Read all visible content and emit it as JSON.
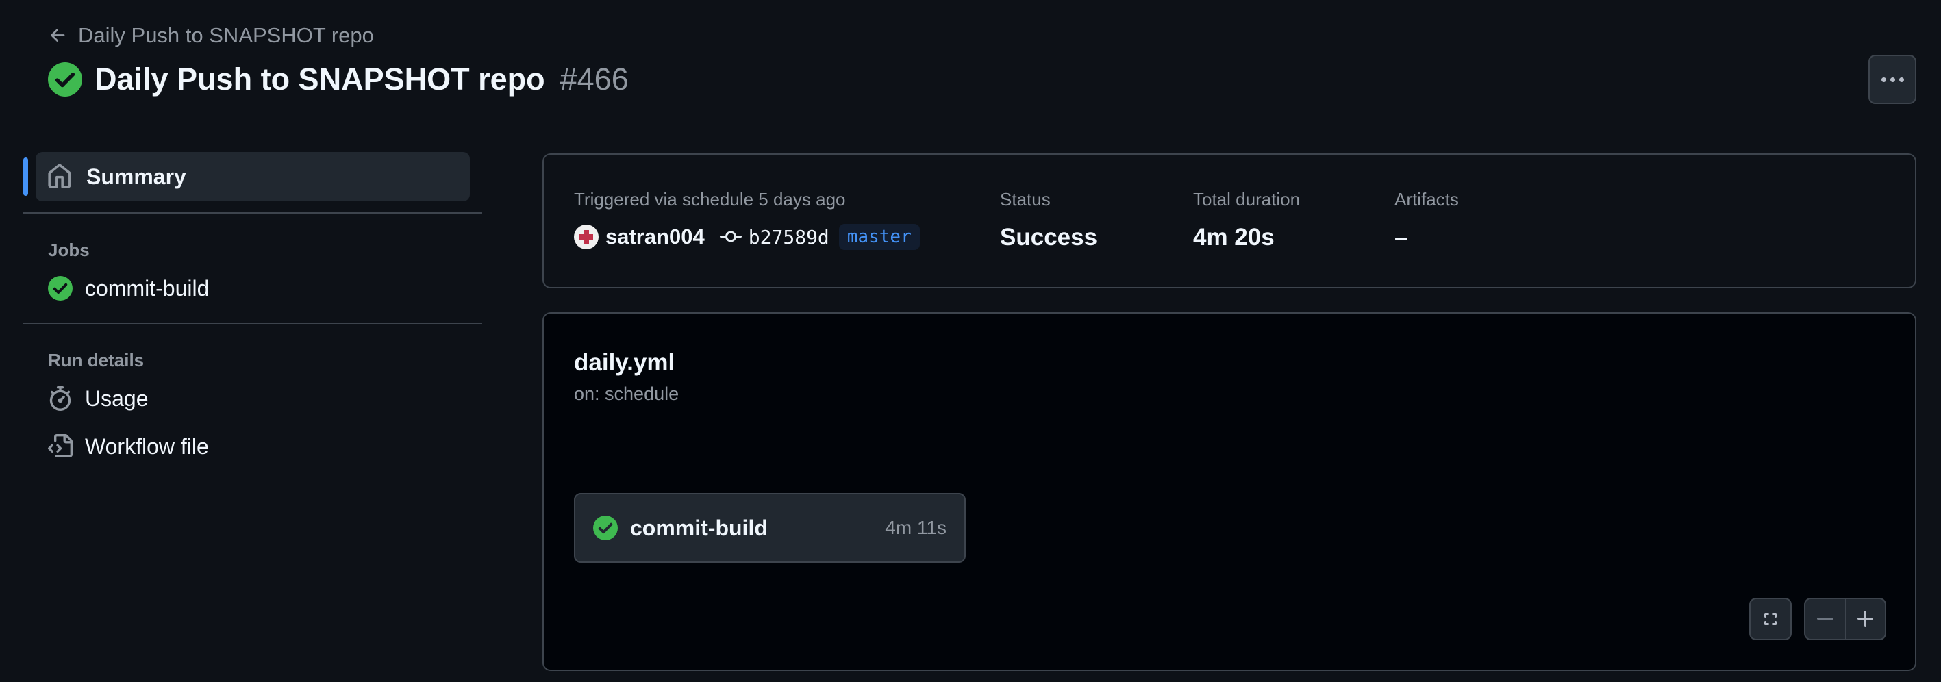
{
  "header": {
    "back_label": "Daily Push to SNAPSHOT repo",
    "title": "Daily Push to SNAPSHOT repo",
    "run_number": "#466"
  },
  "sidebar": {
    "summary_label": "Summary",
    "jobs_heading": "Jobs",
    "jobs": [
      {
        "label": "commit-build",
        "status": "success"
      }
    ],
    "run_details_heading": "Run details",
    "run_details": [
      {
        "label": "Usage",
        "icon": "stopwatch-icon"
      },
      {
        "label": "Workflow file",
        "icon": "file-code-icon"
      }
    ]
  },
  "summary": {
    "triggered_text": "Triggered via schedule 5 days ago",
    "actor": "satran004",
    "commit_sha": "b27589d",
    "branch": "master",
    "status_label": "Status",
    "status_value": "Success",
    "duration_label": "Total duration",
    "duration_value": "4m 20s",
    "artifacts_label": "Artifacts",
    "artifacts_value": "–"
  },
  "graph": {
    "workflow_file": "daily.yml",
    "trigger": "on: schedule",
    "job": {
      "name": "commit-build",
      "duration": "4m 11s",
      "status": "success"
    }
  },
  "colors": {
    "background": "#0d1117",
    "success": "#3fb950",
    "accent": "#4493f8",
    "border": "#3d444d"
  }
}
